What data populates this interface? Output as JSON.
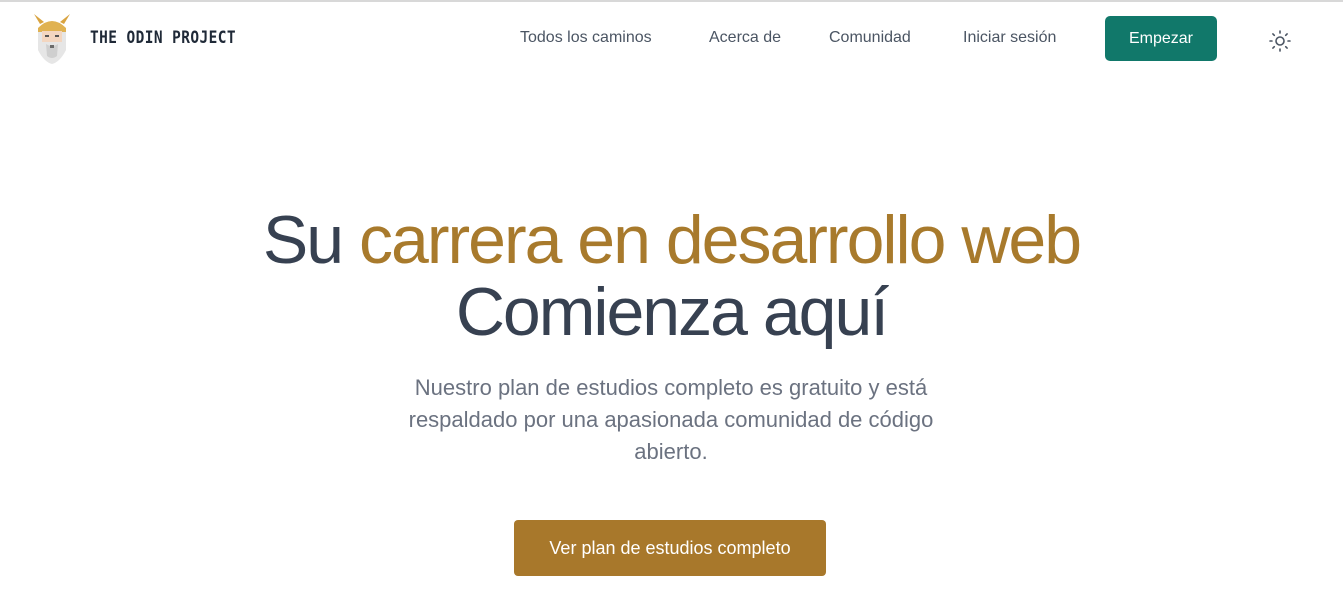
{
  "header": {
    "logo_text": "THE ODIN PROJECT",
    "nav": {
      "paths": "Todos los caminos",
      "about": "Acerca de",
      "community": "Comunidad",
      "login": "Iniciar sesión"
    },
    "cta": "Empezar",
    "theme_icon": "sun-icon"
  },
  "hero": {
    "title_lead": "Su",
    "title_accent": "carrera en desarrollo web",
    "title_line2": "Comienza aquí",
    "subtitle": "Nuestro plan de estudios completo es gratuito y está respaldado por una apasionada comunidad de código abierto.",
    "button": "Ver plan de estudios completo"
  },
  "colors": {
    "primary_green": "#11786a",
    "accent_gold": "#a8782b",
    "heading": "#374151",
    "muted": "#6b7280"
  }
}
